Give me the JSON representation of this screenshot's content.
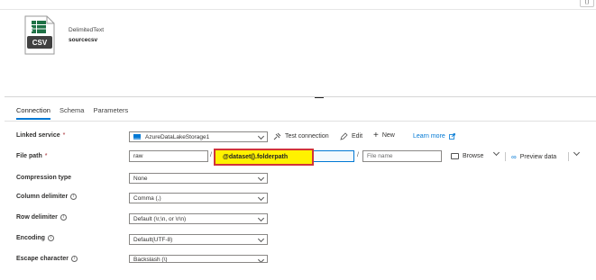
{
  "header": {
    "dataset_type": "DelimitedText",
    "dataset_name": "sourcecsv",
    "file_icon_label": "CSV",
    "corner_button_icon": "restore-icon"
  },
  "tabs": [
    {
      "label": "Connection",
      "active": true
    },
    {
      "label": "Schema",
      "active": false
    },
    {
      "label": "Parameters",
      "active": false
    }
  ],
  "form": {
    "linked_service": {
      "label": "Linked service",
      "required_mark": "*",
      "value": "AzureDataLakeStorage1",
      "test_connection": "Test connection",
      "edit": "Edit",
      "new": "New",
      "learn_more": "Learn more"
    },
    "file_path": {
      "label": "File path",
      "required_mark": "*",
      "container": "raw",
      "directory": "@dataset().folderpath",
      "separator": "/",
      "file_placeholder": "File name",
      "browse": "Browse",
      "preview_data": "Preview data"
    },
    "compression_type": {
      "label": "Compression type",
      "value": "None"
    },
    "column_delimiter": {
      "label": "Column delimiter",
      "value": "Comma (,)"
    },
    "row_delimiter": {
      "label": "Row delimiter",
      "value": "Default (\\r,\\n, or \\r\\n)"
    },
    "encoding": {
      "label": "Encoding",
      "value": "Default(UTF-8)"
    },
    "escape_character": {
      "label": "Escape character",
      "value": "Backslash (\\)"
    }
  },
  "colors": {
    "accent": "#0078d4",
    "highlight_fill": "#fff200",
    "highlight_border": "#d13438",
    "required": "#a4262c"
  }
}
